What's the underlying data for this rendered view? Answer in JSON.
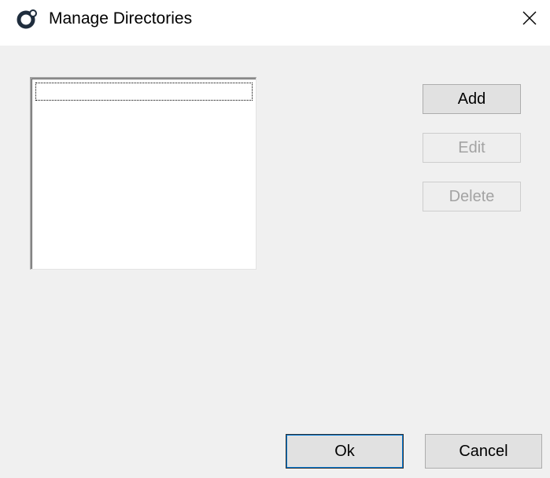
{
  "window": {
    "title": "Manage Directories",
    "app_icon": "gear-ring-icon",
    "close_icon": "close-icon"
  },
  "list": {
    "items": [
      ""
    ]
  },
  "buttons": {
    "add": "Add",
    "edit": "Edit",
    "delete": "Delete",
    "ok": "Ok",
    "cancel": "Cancel"
  },
  "colors": {
    "window_bg": "#f0f0f0",
    "button_bg": "#e1e1e1",
    "disabled_text": "#a3a3a3",
    "focus_accent": "#0078d7"
  }
}
